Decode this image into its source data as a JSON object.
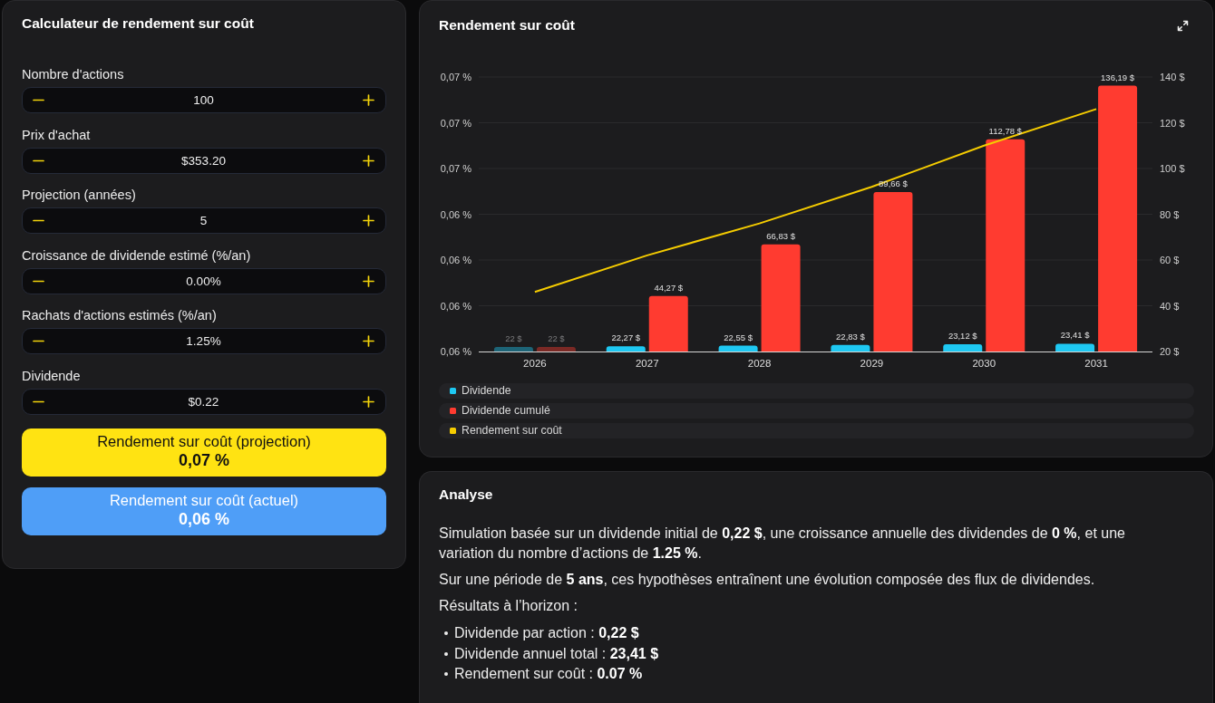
{
  "calculator": {
    "title": "Calculateur de rendement sur coût",
    "fields": [
      {
        "label": "Nombre d'actions",
        "value": "100"
      },
      {
        "label": "Prix d'achat",
        "value": "$353.20"
      },
      {
        "label": "Projection (années)",
        "value": "5"
      },
      {
        "label": "Croissance de dividende estimé (%/an)",
        "value": "0.00%"
      },
      {
        "label": "Rachats d'actions estimés (%/an)",
        "value": "1.25%"
      },
      {
        "label": "Dividende",
        "value": "$0.22"
      }
    ],
    "results": [
      {
        "label": "Rendement sur coût (projection)",
        "value": "0,07 %",
        "color": "#ffe312"
      },
      {
        "label": "Rendement sur coût (actuel)",
        "value": "0,06 %",
        "color": "#4f9ef7"
      }
    ]
  },
  "chart_panel": {
    "title": "Rendement sur coût",
    "dimmed": [
      true,
      false,
      false,
      false,
      false,
      false
    ],
    "chart_data": {
      "type": "bar",
      "categories": [
        "2026",
        "2027",
        "2028",
        "2029",
        "2030",
        "2031"
      ],
      "series": [
        {
          "name": "Dividende",
          "color": "#1ec8f2",
          "type": "bar",
          "axis": "y2",
          "values": [
            22,
            22.27,
            22.55,
            22.83,
            23.12,
            23.41
          ],
          "value_labels": [
            "22 $",
            "22,27 $",
            "22,55 $",
            "22,83 $",
            "23,12 $",
            "23,41 $"
          ]
        },
        {
          "name": "Dividende cumulé",
          "color": "#ff3b30",
          "type": "bar",
          "axis": "y2",
          "values": [
            22,
            44.27,
            66.83,
            89.66,
            112.78,
            136.19
          ],
          "value_labels": [
            "22 $",
            "44,27 $",
            "66,83 $",
            "89,66 $",
            "112,78 $",
            "136,19 $"
          ]
        },
        {
          "name": "Rendement sur coût",
          "color": "#f5cc00",
          "type": "line",
          "values": [
            0.0623,
            0.0631,
            0.0638,
            0.0646,
            0.0655,
            0.0663
          ]
        }
      ],
      "ylim": [
        0.061,
        0.067
      ],
      "yticks": [
        {
          "value": 0.061,
          "label": "0,06 %"
        },
        {
          "value": 0.062,
          "label": "0,06 %"
        },
        {
          "value": 0.063,
          "label": "0,06 %"
        },
        {
          "value": 0.064,
          "label": "0,06 %"
        },
        {
          "value": 0.065,
          "label": "0,07 %"
        },
        {
          "value": 0.066,
          "label": "0,07 %"
        },
        {
          "value": 0.067,
          "label": "0,07 %"
        }
      ],
      "y2lim": [
        20,
        140
      ],
      "y2ticks": [
        {
          "value": 20,
          "label": "20 $"
        },
        {
          "value": 40,
          "label": "40 $"
        },
        {
          "value": 60,
          "label": "60 $"
        },
        {
          "value": 80,
          "label": "80 $"
        },
        {
          "value": 100,
          "label": "100 $"
        },
        {
          "value": 120,
          "label": "120 $"
        },
        {
          "value": 140,
          "label": "140 $"
        }
      ],
      "grid": true
    }
  },
  "analysis": {
    "title": "Analyse",
    "paragraphs": [
      "Simulation basée sur un dividende initial de **0,22 $**, une croissance annuelle des dividendes de **0 %**, et une variation du nombre d’actions de **1.25 %**.",
      "Sur une période de **5 ans**, ces hypothèses entraînent une évolution composée des flux de dividendes.",
      "Résultats à l’horizon :"
    ],
    "items": [
      "Dividende par action : **0,22 $**",
      "Dividende annuel total : **23,41 $**",
      "Rendement sur coût : **0.07 %**"
    ]
  }
}
